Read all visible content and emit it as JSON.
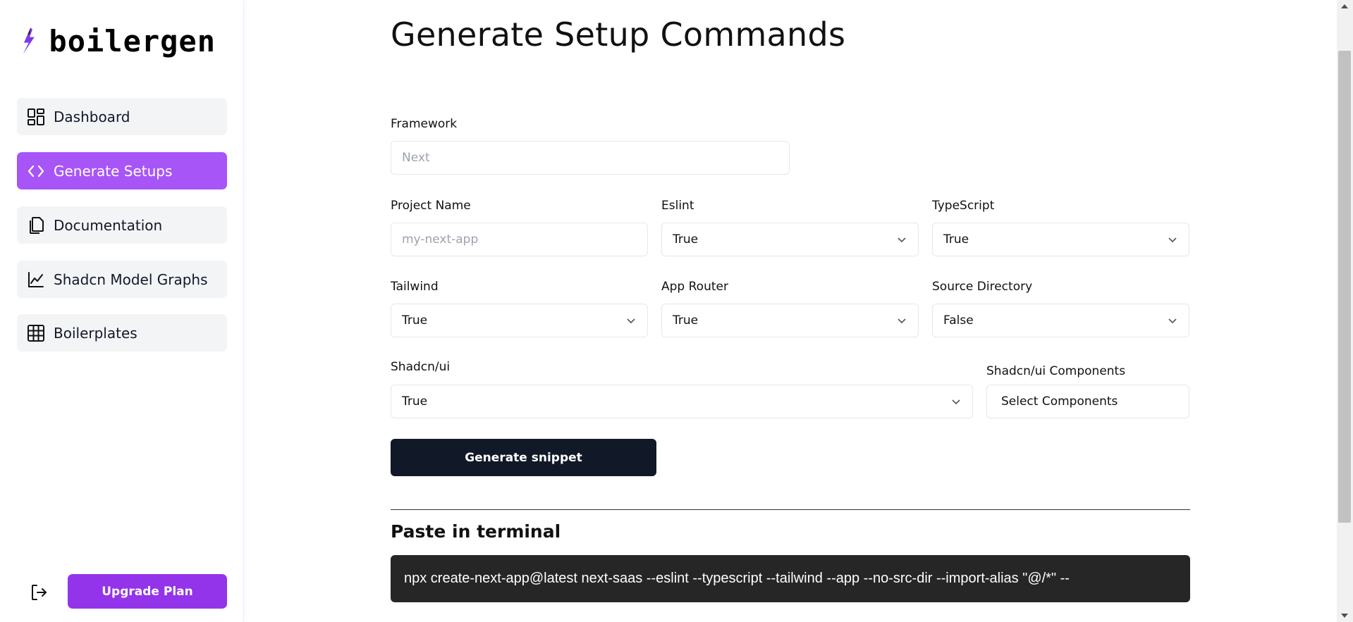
{
  "sidebar": {
    "brand": "boilergen",
    "items": [
      {
        "label": "Dashboard",
        "icon": "dashboard-icon"
      },
      {
        "label": "Generate Setups",
        "icon": "code-icon",
        "active": true
      },
      {
        "label": "Documentation",
        "icon": "documents-icon"
      },
      {
        "label": "Shadcn Model Graphs",
        "icon": "line-chart-icon"
      },
      {
        "label": "Boilerplates",
        "icon": "grid-icon"
      }
    ],
    "upgrade_label": "Upgrade Plan"
  },
  "main": {
    "title": "Generate Setup Commands",
    "framework": {
      "label": "Framework",
      "placeholder": "Next"
    },
    "project_name": {
      "label": "Project Name",
      "placeholder": "my-next-app"
    },
    "eslint": {
      "label": "Eslint",
      "value": "True"
    },
    "typescript": {
      "label": "TypeScript",
      "value": "True"
    },
    "tailwind": {
      "label": "Tailwind",
      "value": "True"
    },
    "app_router": {
      "label": "App Router",
      "value": "True"
    },
    "source_directory": {
      "label": "Source Directory",
      "value": "False"
    },
    "shadcn": {
      "label": "Shadcn/ui",
      "value": "True"
    },
    "shadcn_components": {
      "label": "Shadcn/ui Components",
      "value": "Select Components"
    },
    "generate_label": "Generate snippet",
    "paste_title": "Paste in terminal",
    "command": "npx create-next-app@latest next-saas --eslint --typescript --tailwind --app --no-src-dir --import-alias \"@/*\" --"
  },
  "colors": {
    "accent": "#a855f7",
    "upgrade": "#9333ea",
    "button_dark": "#111827",
    "terminal_bg": "#262626"
  }
}
